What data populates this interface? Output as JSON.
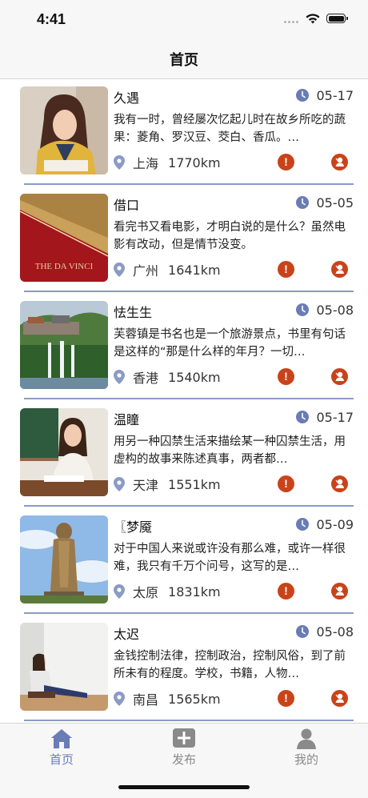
{
  "status_bar": {
    "time": "4:41"
  },
  "nav": {
    "title": "首页"
  },
  "colors": {
    "accent": "#6a7cb6",
    "alert": "#c9431a",
    "divider": "#8a9bc4",
    "icon_gray": "#8a9bc4"
  },
  "list": {
    "items": [
      {
        "title": "久遇",
        "date": "05-17",
        "summary": "我有一时，曾经屡次忆起儿时在故乡所吃的蔬果：菱角、罗汉豆、茭白、香瓜。…",
        "city": "上海",
        "distance": "1770km",
        "thumb": "woman-reading-yellow"
      },
      {
        "title": "借口",
        "date": "05-05",
        "summary": "看完书又看电影，才明白说的是什么？虽然电影有改动，但是情节没变。",
        "city": "广州",
        "distance": "1641km",
        "thumb": "da-vinci-book-cover",
        "thumb_text": "THE DA VINCI"
      },
      {
        "title": "怯生生",
        "date": "05-08",
        "summary": "芙蓉镇是书名也是一个旅游景点，书里有句话是这样的“那是什么样的年月？一切…",
        "city": "香港",
        "distance": "1540km",
        "thumb": "waterfall-town"
      },
      {
        "title": "温瞳",
        "date": "05-17",
        "summary": "用另一种囚禁生活来描绘某一种囚禁生活，用虚构的故事来陈述真事，两者都…",
        "city": "天津",
        "distance": "1551km",
        "thumb": "woman-writing-desk"
      },
      {
        "title": "〖梦魇",
        "date": "05-09",
        "summary": "对于中国人来说或许没有那么难，或许一样很难，我只有千万个问号，这写的是…",
        "city": "太原",
        "distance": "1831km",
        "thumb": "confucius-statue"
      },
      {
        "title": "太迟",
        "date": "05-08",
        "summary": "金钱控制法律，控制政治，控制风俗，到了前所未有的程度。学校，书籍，人物…",
        "city": "南昌",
        "distance": "1565km",
        "thumb": "woman-sitting-reading"
      }
    ]
  },
  "tabbar": {
    "tabs": [
      {
        "label": "首页",
        "icon": "home-icon",
        "active": true
      },
      {
        "label": "发布",
        "icon": "plus-square-icon",
        "active": false
      },
      {
        "label": "我的",
        "icon": "person-icon",
        "active": false
      }
    ]
  }
}
